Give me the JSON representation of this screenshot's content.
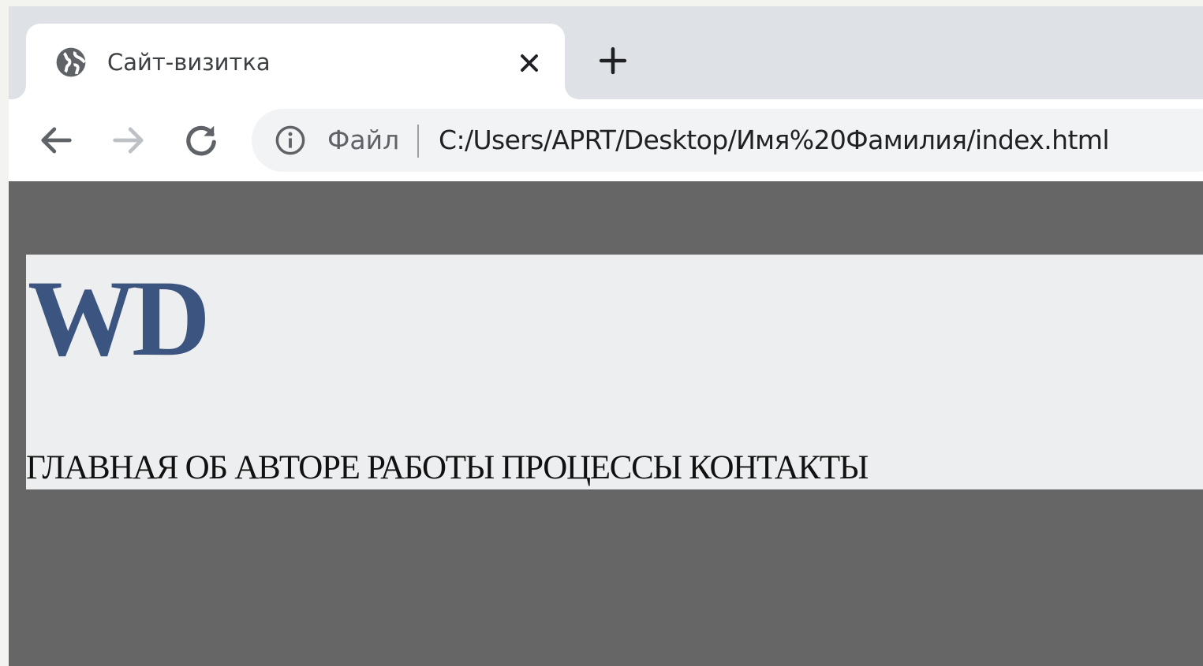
{
  "browser": {
    "tab": {
      "title": "Сайт-визитка",
      "favicon": "globe-icon",
      "close_icon": "close-icon"
    },
    "new_tab_icon": "plus-icon",
    "toolbar": {
      "back_icon": "arrow-left-icon",
      "forward_icon": "arrow-right-icon",
      "reload_icon": "reload-icon"
    },
    "omnibox": {
      "info_icon": "info-icon",
      "file_label": "Файл",
      "url": "C:/Users/APRT/Desktop/Имя%20Фамилия/index.html"
    }
  },
  "page": {
    "logo": "WD",
    "nav": [
      "ГЛАВНАЯ",
      "ОБ АВТОРЕ",
      "РАБОТЫ",
      "ПРОЦЕССЫ",
      "КОНТАКТЫ"
    ]
  },
  "colors": {
    "page_background": "#666666",
    "header_background": "#edeef0",
    "logo": "#3b5580",
    "tabstrip": "#dee1e6",
    "omnibox": "#f1f3f4"
  }
}
